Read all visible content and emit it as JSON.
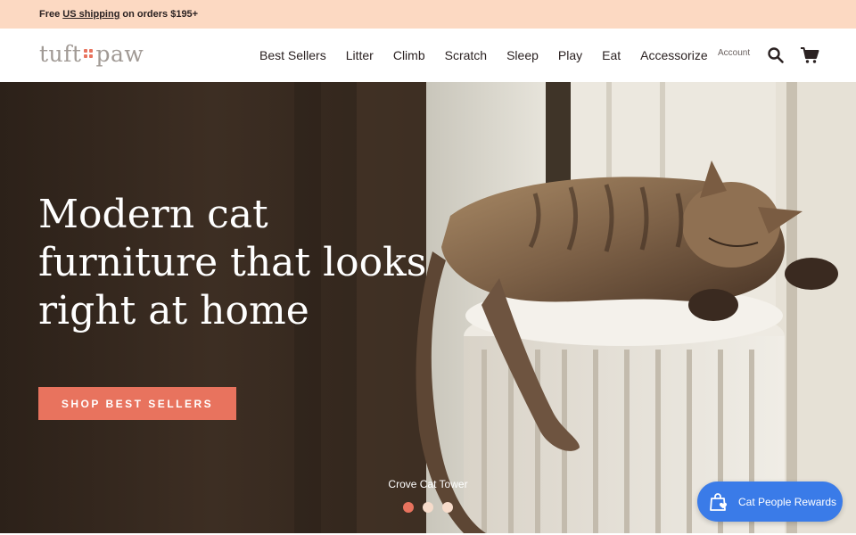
{
  "promo": {
    "prefix": "Free",
    "link": "US shipping",
    "suffix": "on orders $195+"
  },
  "brand": {
    "logo_left": "tuft",
    "logo_right": "paw"
  },
  "nav": {
    "items": [
      "Best Sellers",
      "Litter",
      "Climb",
      "Scratch",
      "Sleep",
      "Play",
      "Eat",
      "Accessorize"
    ],
    "account": "Account"
  },
  "icons": {
    "search": "search-icon",
    "cart": "cart-icon",
    "rewards": "shopping-bag-heart-icon"
  },
  "hero": {
    "title": "Modern cat furniture that looks right at home",
    "cta": "SHOP BEST SELLERS",
    "caption": "Crove Cat Tower",
    "slides": {
      "count": 3,
      "active": 1
    }
  },
  "rewards": {
    "label": "Cat People Rewards"
  },
  "colors": {
    "promo_bg": "#fcd9c2",
    "accent": "#e8735e",
    "logo_gray": "#a19a95",
    "rewards_blue": "#3a7be8",
    "text_dark": "#2b2222"
  }
}
